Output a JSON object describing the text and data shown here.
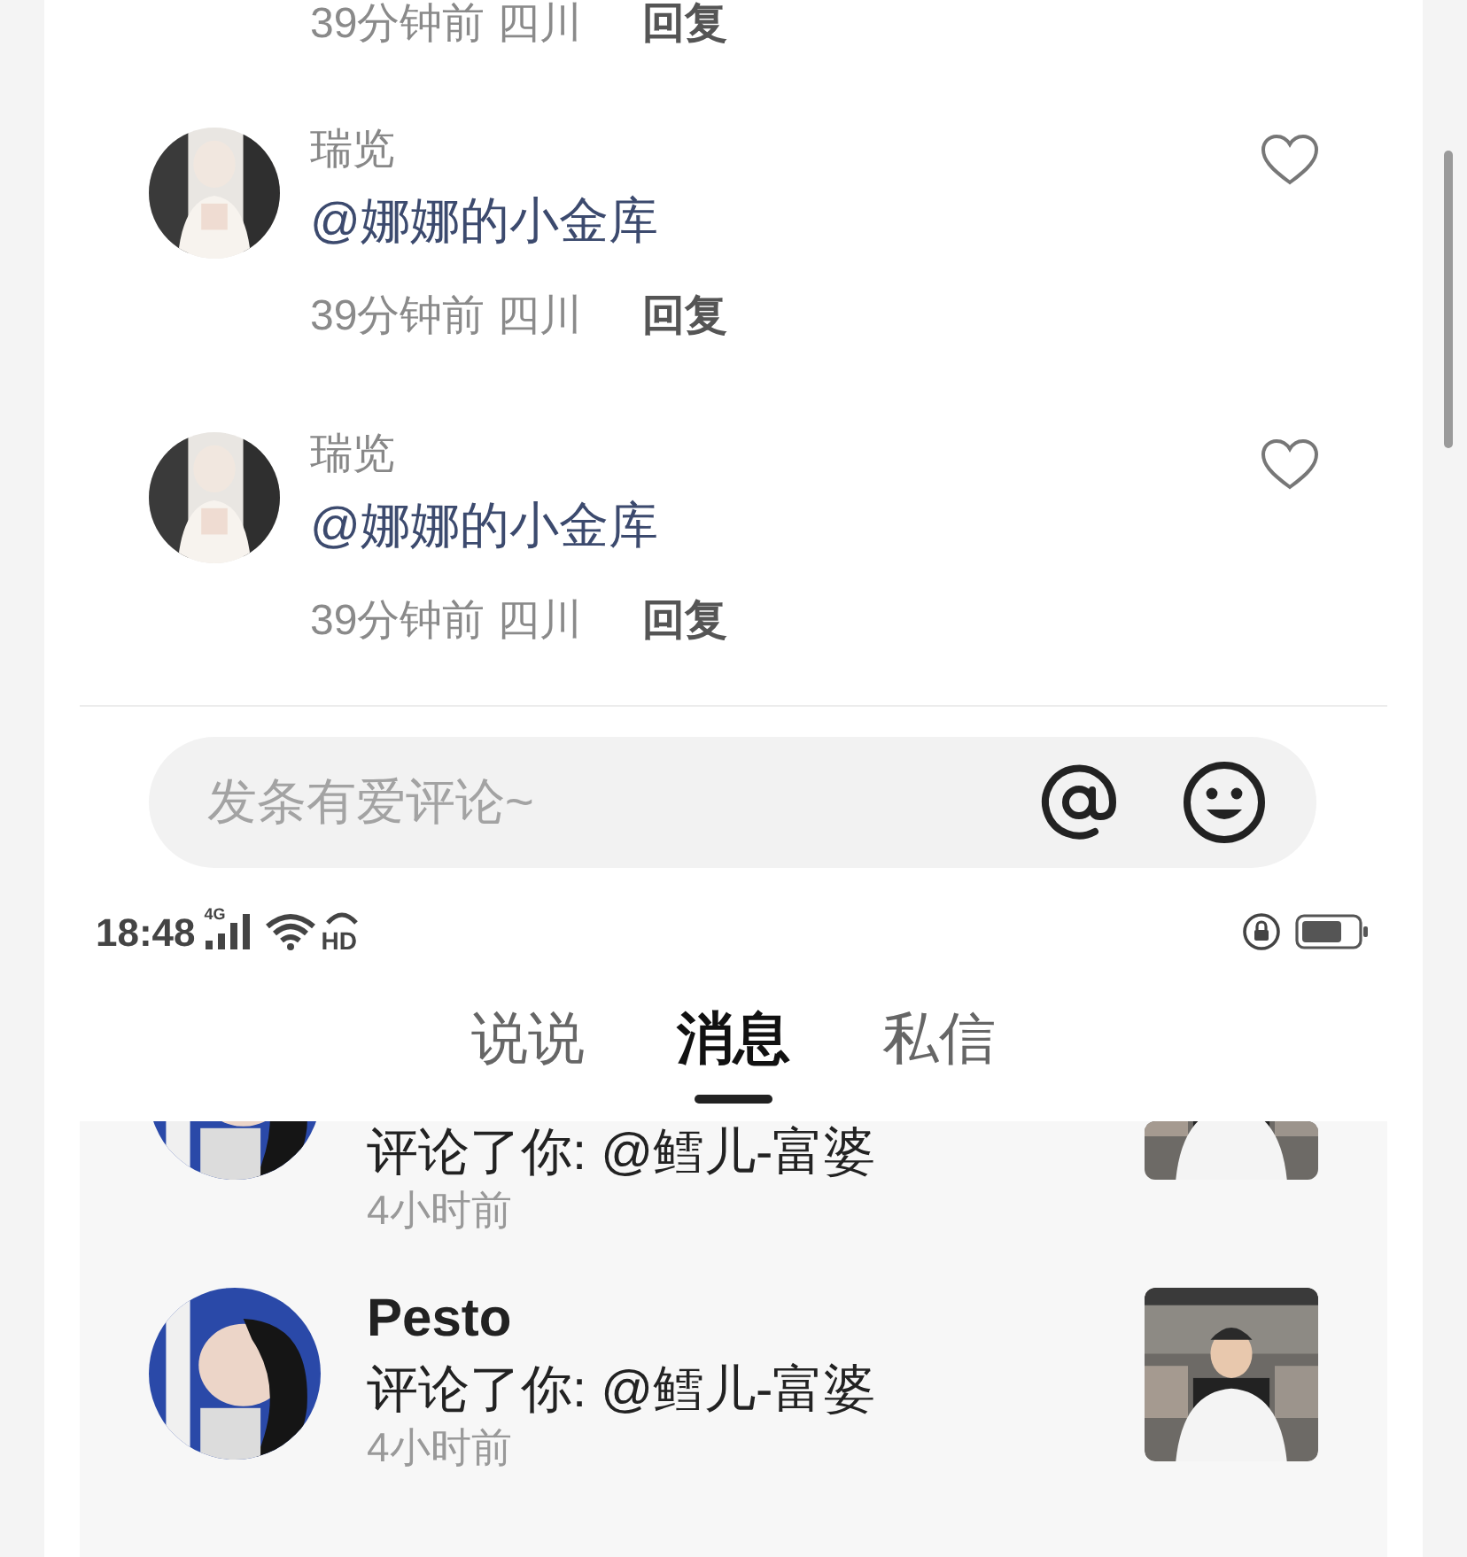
{
  "top_partial_comment": {
    "time": "39分钟前",
    "location": "四川",
    "reply": "回复"
  },
  "comments": [
    {
      "name": "瑞览",
      "text": "@娜娜的小金库",
      "time": "39分钟前",
      "location": "四川",
      "reply": "回复",
      "liked": false
    },
    {
      "name": "瑞览",
      "text": "@娜娜的小金库",
      "time": "39分钟前",
      "location": "四川",
      "reply": "回复",
      "liked": false
    }
  ],
  "comment_input": {
    "placeholder": "发条有爱评论~"
  },
  "status_bar": {
    "time": "18:48",
    "network": "4G",
    "hd": "HD"
  },
  "tabs": [
    {
      "label": "说说",
      "selected": false
    },
    {
      "label": "消息",
      "selected": true
    },
    {
      "label": "私信",
      "selected": false
    }
  ],
  "messages": [
    {
      "text": "评论了你: @鳕儿-富婆",
      "time": "4小时前"
    },
    {
      "name": "Pesto",
      "text": "评论了你: @鳕儿-富婆",
      "time": "4小时前"
    }
  ]
}
